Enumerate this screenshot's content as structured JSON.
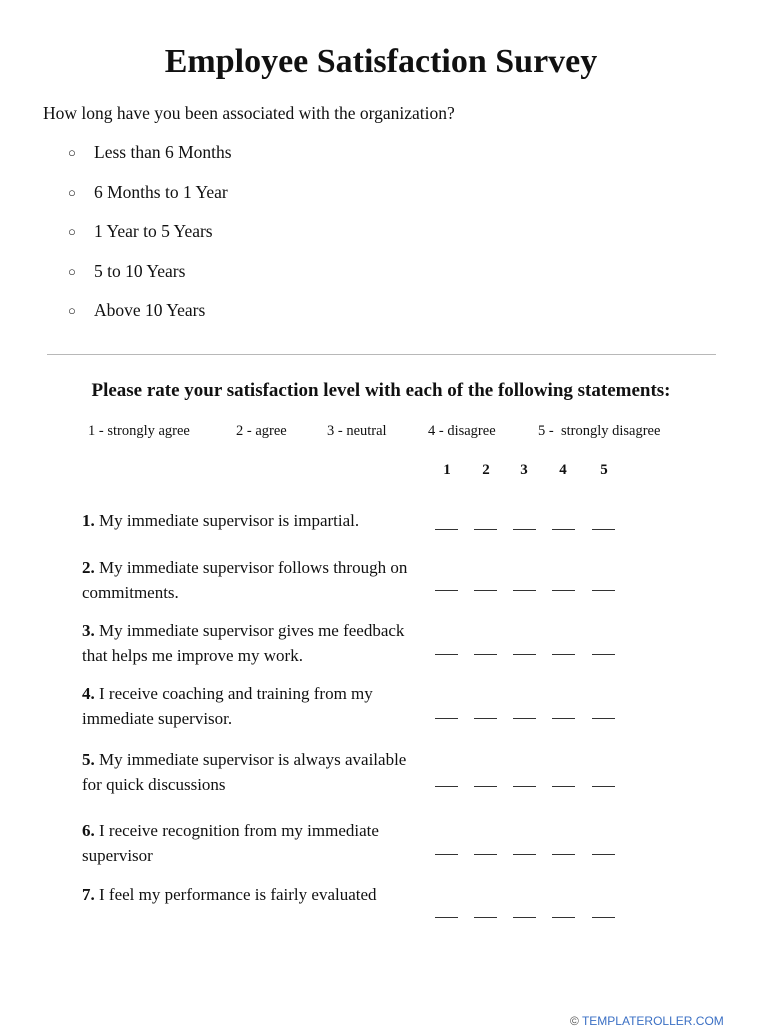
{
  "title": "Employee Satisfaction Survey",
  "tenure": {
    "question": "How long have you been associated with the organization?",
    "options": [
      {
        "label": "Less than 6 Months",
        "icon": "radio-circle-icon"
      },
      {
        "label": "6 Months to 1 Year",
        "icon": "radio-circle-icon"
      },
      {
        "label": "1 Year to 5 Years",
        "icon": "radio-circle-icon"
      },
      {
        "label": "5 to 10 Years",
        "icon": "radio-circle-icon"
      },
      {
        "label": "Above 10 Years",
        "icon": "radio-circle-icon"
      }
    ],
    "bullet_glyph": "○"
  },
  "rating": {
    "heading": "Please rate your satisfaction level with each of the following statements:",
    "scale_legend": [
      "1 - strongly agree",
      "2 - agree",
      "3 - neutral",
      "4 - disagree",
      "5 -  strongly disagree"
    ],
    "columns": [
      "1",
      "2",
      "3",
      "4",
      "5"
    ],
    "statements": [
      {
        "number": "1.",
        "text": "My immediate supervisor is impartial."
      },
      {
        "number": "2.",
        "text": "My immediate supervisor follows through on commitments."
      },
      {
        "number": "3.",
        "text": "My immediate supervisor gives me feedback that helps me improve my work."
      },
      {
        "number": "4.",
        "text": "I receive coaching and training from my immediate supervisor."
      },
      {
        "number": "5.",
        "text": "My immediate supervisor is always available for quick discussions"
      },
      {
        "number": "6.",
        "text": "I receive recognition from my immediate supervisor"
      },
      {
        "number": "7.",
        "text": "I feel my performance is fairly evaluated"
      }
    ]
  },
  "footer": {
    "copyright_symbol": "©",
    "text": "TEMPLATEROLLER.COM",
    "color": "#3a6fc4"
  }
}
